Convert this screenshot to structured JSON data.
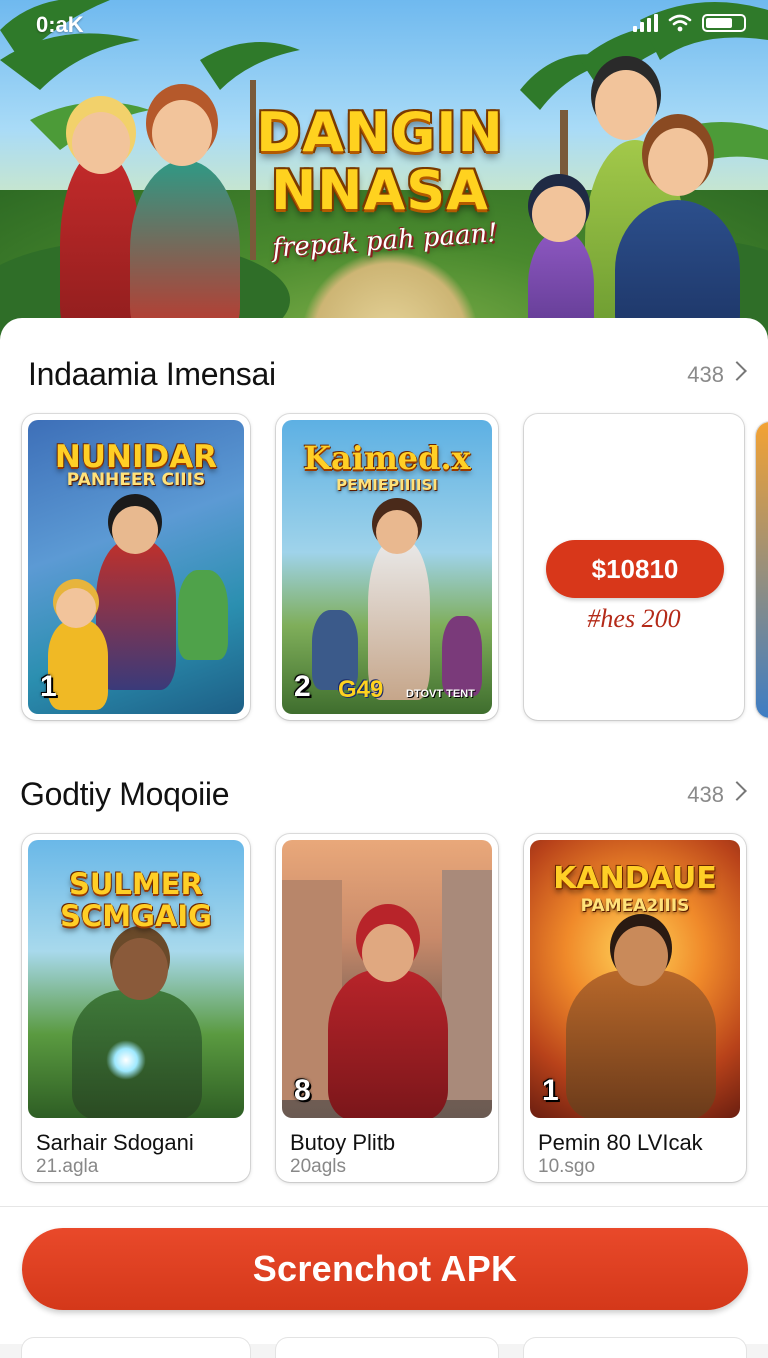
{
  "status_bar": {
    "time": "0:aK"
  },
  "hero": {
    "title_line1": "DANGIN",
    "title_line2": "NNASA",
    "subtitle": "frepak pah paan!"
  },
  "section1": {
    "title": "Indaamia Imensai",
    "count": "438",
    "cards": [
      {
        "art_title": "NUNIDAR",
        "art_sub": "PANHEER CIIIS",
        "rank": "1"
      },
      {
        "art_title": "Kaimed.x",
        "art_sub": "PEMIEPIIIISI",
        "rank": "2",
        "logo": "G49",
        "logo_sub": "DTOVT TENT"
      },
      {
        "price": "$10810",
        "note": "#hes 200"
      }
    ]
  },
  "section2": {
    "title": "Godtiy Moqoiie",
    "count": "438",
    "cards": [
      {
        "art_title": "SULMER",
        "art_title2": "SCMGAIG",
        "name": "Sarhair Sdogani",
        "meta": "21.agla"
      },
      {
        "rank": "8",
        "name": "Butoy Plitb",
        "meta": "20agls"
      },
      {
        "art_title": "KANDAUE",
        "art_sub": "PAMEA2IIIS",
        "rank": "1",
        "name": "Pemin 80 LVIcak",
        "meta": "10.sgo"
      }
    ]
  },
  "cta": {
    "label": "Screnchot APK"
  },
  "colors": {
    "accent": "#d8371a",
    "title_gold": "#ffd21f"
  }
}
